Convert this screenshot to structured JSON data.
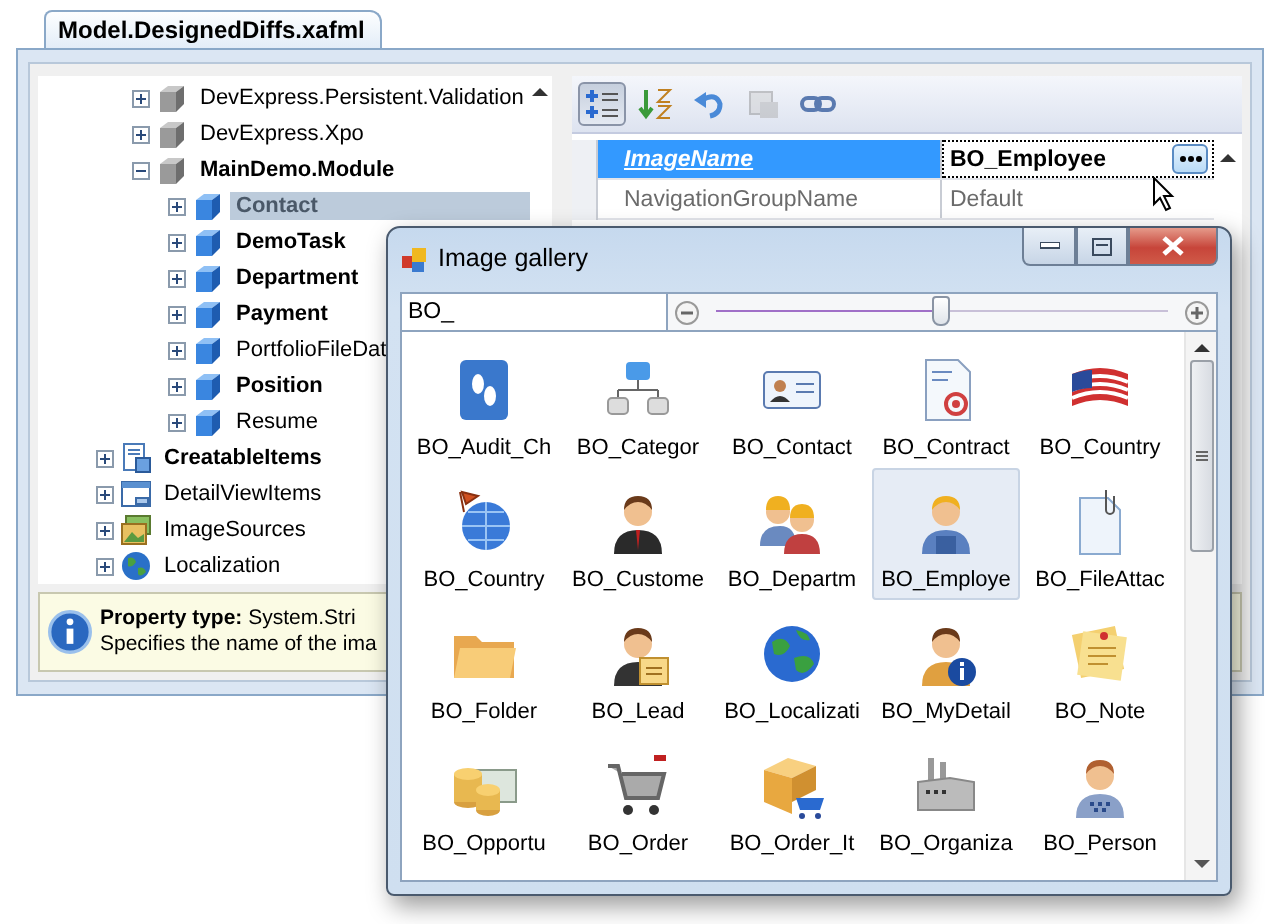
{
  "document_tab": {
    "label": "Model.DesignedDiffs.xafml",
    "selected": true
  },
  "tree": {
    "modules": [
      {
        "label": "DevExpress.Persistent.Validation",
        "kind": "module",
        "bold": false,
        "expanded": false,
        "selected": false
      },
      {
        "label": "DevExpress.Xpo",
        "kind": "module",
        "bold": false,
        "expanded": false,
        "selected": false
      },
      {
        "label": "MainDemo.Module",
        "kind": "module",
        "bold": true,
        "expanded": true,
        "selected": false,
        "children": [
          {
            "label": "Contact",
            "kind": "class",
            "bold": true,
            "expanded": false,
            "selected": true
          },
          {
            "label": "DemoTask",
            "kind": "class",
            "bold": true,
            "expanded": false,
            "selected": false
          },
          {
            "label": "Department",
            "kind": "class",
            "bold": true,
            "expanded": false,
            "selected": false
          },
          {
            "label": "Payment",
            "kind": "class",
            "bold": true,
            "expanded": false,
            "selected": false
          },
          {
            "label": "PortfolioFileDat",
            "kind": "class",
            "bold": false,
            "expanded": false,
            "selected": false
          },
          {
            "label": "Position",
            "kind": "class",
            "bold": true,
            "expanded": false,
            "selected": false
          },
          {
            "label": "Resume",
            "kind": "class",
            "bold": false,
            "expanded": false,
            "selected": false
          }
        ]
      }
    ],
    "items": [
      {
        "label": "CreatableItems",
        "kind": "creatable",
        "bold": true,
        "expanded": false,
        "selected": false
      },
      {
        "label": "DetailViewItems",
        "kind": "detail",
        "bold": false,
        "expanded": false,
        "selected": false
      },
      {
        "label": "ImageSources",
        "kind": "images",
        "bold": false,
        "expanded": false,
        "selected": false
      },
      {
        "label": "Localization",
        "kind": "localization",
        "bold": false,
        "expanded": false,
        "selected": false
      }
    ]
  },
  "property_grid": {
    "toolbar": [
      {
        "kind": "categorized",
        "pressed": true,
        "disabled": false
      },
      {
        "kind": "alphabetical",
        "pressed": false,
        "disabled": false
      },
      {
        "kind": "undo",
        "pressed": false,
        "disabled": false
      },
      {
        "kind": "pages",
        "pressed": false,
        "disabled": true
      },
      {
        "kind": "link",
        "pressed": false,
        "disabled": false
      }
    ],
    "rows": [
      {
        "name": "ImageName",
        "value": "BO_Employee",
        "selected": true,
        "modified": true
      },
      {
        "name": "NavigationGroupName",
        "value": "Default",
        "selected": false,
        "modified": false
      }
    ]
  },
  "description": {
    "type_line": "**Property type:** System.Stri",
    "text": "Specifies the name of the ima"
  },
  "image_gallery": {
    "title": "Image gallery",
    "search": {
      "value": "BO_"
    },
    "zoom": {
      "level": 0.5
    },
    "images": [
      {
        "label": "BO_Audit_Ch",
        "selected": false
      },
      {
        "label": "BO_Categor",
        "selected": false
      },
      {
        "label": "BO_Contact",
        "selected": false
      },
      {
        "label": "BO_Contract",
        "selected": false
      },
      {
        "label": "BO_Country",
        "selected": false
      },
      {
        "label": "BO_Country",
        "selected": false
      },
      {
        "label": "BO_Custome",
        "selected": false
      },
      {
        "label": "BO_Departm",
        "selected": false
      },
      {
        "label": "BO_Employe",
        "selected": true
      },
      {
        "label": "BO_FileAttac",
        "selected": false
      },
      {
        "label": "BO_Folder",
        "selected": false
      },
      {
        "label": "BO_Lead",
        "selected": false
      },
      {
        "label": "BO_Localizati",
        "selected": false
      },
      {
        "label": "BO_MyDetail",
        "selected": false
      },
      {
        "label": "BO_Note",
        "selected": false
      },
      {
        "label": "BO_Opportu",
        "selected": false
      },
      {
        "label": "BO_Order",
        "selected": false
      },
      {
        "label": "BO_Order_It",
        "selected": false
      },
      {
        "label": "BO_Organiza",
        "selected": false
      },
      {
        "label": "BO_Person",
        "selected": false
      }
    ]
  }
}
